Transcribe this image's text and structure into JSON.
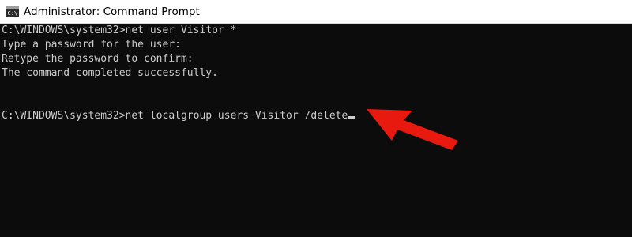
{
  "window": {
    "title": "Administrator: Command Prompt",
    "icon": "cmd-icon"
  },
  "console": {
    "lines": [
      "C:\\WINDOWS\\system32>net user Visitor *",
      "Type a password for the user:",
      "Retype the password to confirm:",
      "The command completed successfully.",
      "",
      "",
      "C:\\WINDOWS\\system32>net localgroup users Visitor /delete"
    ]
  },
  "annotation": {
    "color": "#e8190f",
    "icon": "red-arrow-pointer"
  },
  "colors": {
    "background": "#0c0c0c",
    "text": "#cccccc",
    "titlebar": "#ffffff"
  }
}
